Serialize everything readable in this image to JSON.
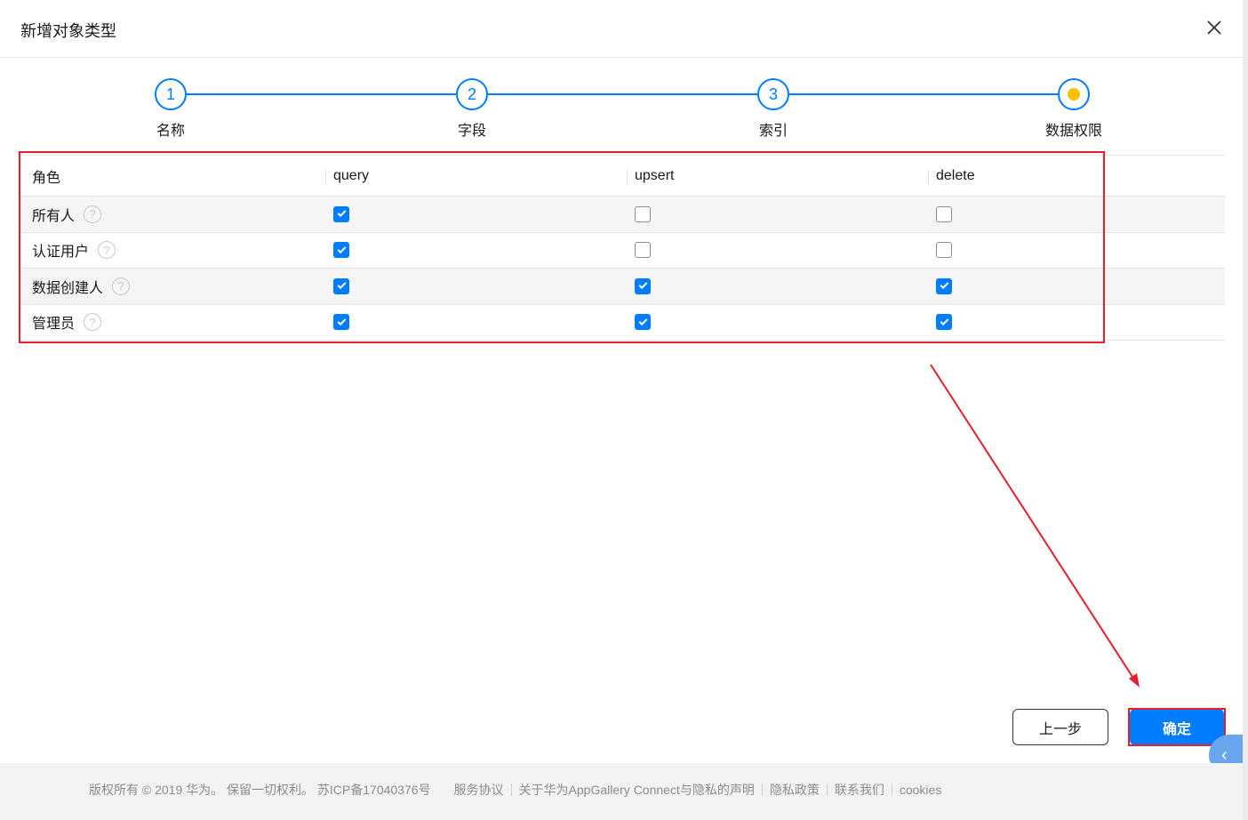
{
  "dialog": {
    "title": "新增对象类型"
  },
  "steps": [
    {
      "number": "1",
      "label": "名称",
      "state": "done"
    },
    {
      "number": "2",
      "label": "字段",
      "state": "done"
    },
    {
      "number": "3",
      "label": "索引",
      "state": "done"
    },
    {
      "number": "",
      "label": "数据权限",
      "state": "current"
    }
  ],
  "table": {
    "headers": [
      "角色",
      "query",
      "upsert",
      "delete"
    ],
    "rows": [
      {
        "role": "所有人",
        "query": true,
        "upsert": false,
        "delete": false
      },
      {
        "role": "认证用户",
        "query": true,
        "upsert": false,
        "delete": false
      },
      {
        "role": "数据创建人",
        "query": true,
        "upsert": true,
        "delete": true
      },
      {
        "role": "管理员",
        "query": true,
        "upsert": true,
        "delete": true
      }
    ]
  },
  "buttons": {
    "prev": "上一步",
    "confirm": "确定"
  },
  "footer": {
    "copyright": "版权所有 © 2019 华为。 保留一切权利。 苏ICP备17040376号",
    "links": [
      "服务协议",
      "关于华为AppGallery Connect与隐私的声明",
      "隐私政策",
      "联系我们",
      "cookies"
    ]
  },
  "colors": {
    "primary": "#007dff",
    "current_step": "#ffbf00",
    "annotation": "#e3202b"
  },
  "icons": {
    "close": "close-icon",
    "help": "help-circle-icon",
    "side": "chevron-left-icon"
  }
}
